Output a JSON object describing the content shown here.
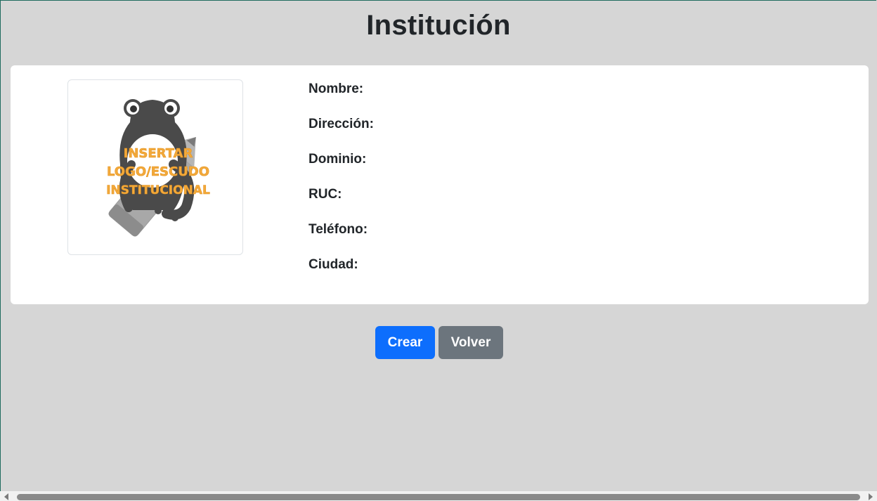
{
  "page": {
    "title": "Institución"
  },
  "institution": {
    "logo_placeholder_lines": [
      "INSERTAR",
      "LOGO/ESCUDO",
      "INSTITUCIONAL"
    ],
    "fields": [
      {
        "label": "Nombre:"
      },
      {
        "label": "Dirección:"
      },
      {
        "label": "Dominio:"
      },
      {
        "label": "RUC:"
      },
      {
        "label": "Teléfono:"
      },
      {
        "label": "Ciudad:"
      }
    ]
  },
  "actions": {
    "create_label": "Crear",
    "back_label": "Volver"
  },
  "colors": {
    "background": "#d6d6d6",
    "primary": "#0d6efd",
    "secondary": "#6c757d",
    "logo_text": "#f2a93b",
    "logo_frog": "#4a4a4a"
  },
  "icons": {
    "logo": "frog-pencil-logo-icon",
    "scroll_left": "scroll-left-arrow-icon",
    "scroll_right": "scroll-right-arrow-icon"
  }
}
